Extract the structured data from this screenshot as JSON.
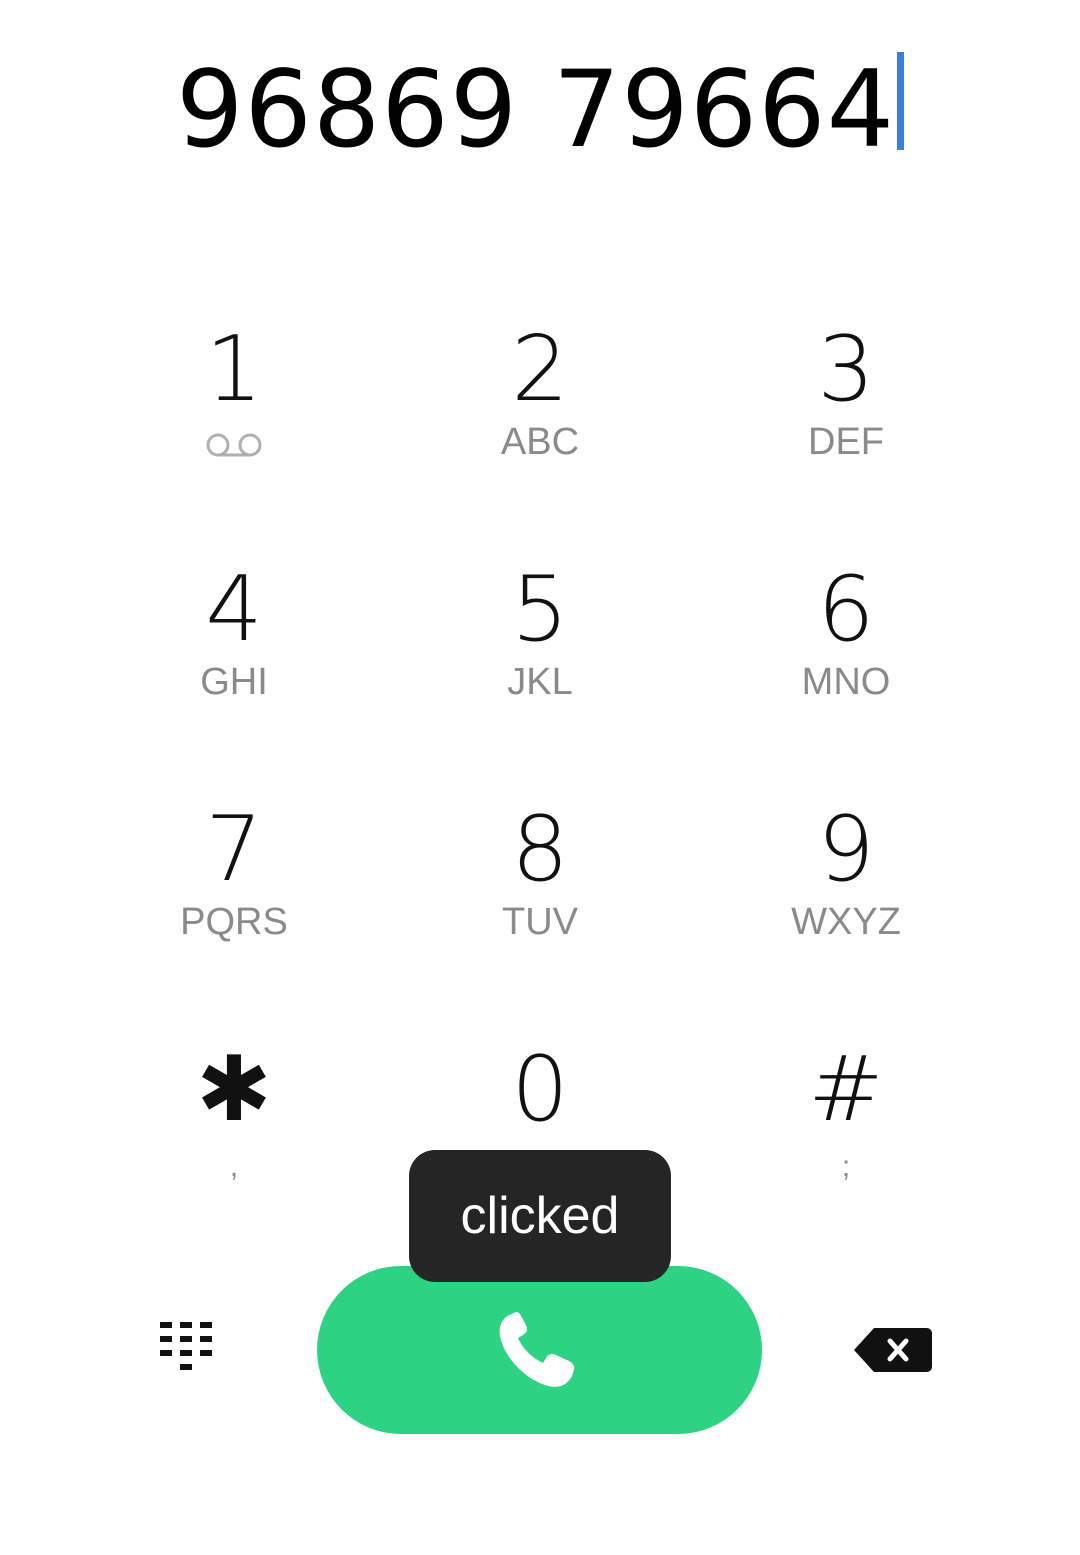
{
  "display": {
    "number": "96869 79664"
  },
  "keypad": {
    "keys": [
      {
        "digit": "1",
        "sub": "",
        "sub_icon": "voicemail-icon"
      },
      {
        "digit": "2",
        "sub": "ABC"
      },
      {
        "digit": "3",
        "sub": "DEF"
      },
      {
        "digit": "4",
        "sub": "GHI"
      },
      {
        "digit": "5",
        "sub": "JKL"
      },
      {
        "digit": "6",
        "sub": "MNO"
      },
      {
        "digit": "7",
        "sub": "PQRS"
      },
      {
        "digit": "8",
        "sub": "TUV"
      },
      {
        "digit": "9",
        "sub": "WXYZ"
      },
      {
        "digit": "✱",
        "sub": ","
      },
      {
        "digit": "0",
        "sub": ""
      },
      {
        "digit": "#",
        "sub": ";"
      }
    ]
  },
  "toast": {
    "text": "clicked"
  },
  "actions": {
    "call_icon": "phone-icon",
    "dialpad_icon": "dialpad-icon",
    "backspace_icon": "backspace-icon"
  },
  "colors": {
    "call_button": "#2dd282",
    "caret": "#3b7ddd",
    "toast_bg": "#252525"
  }
}
